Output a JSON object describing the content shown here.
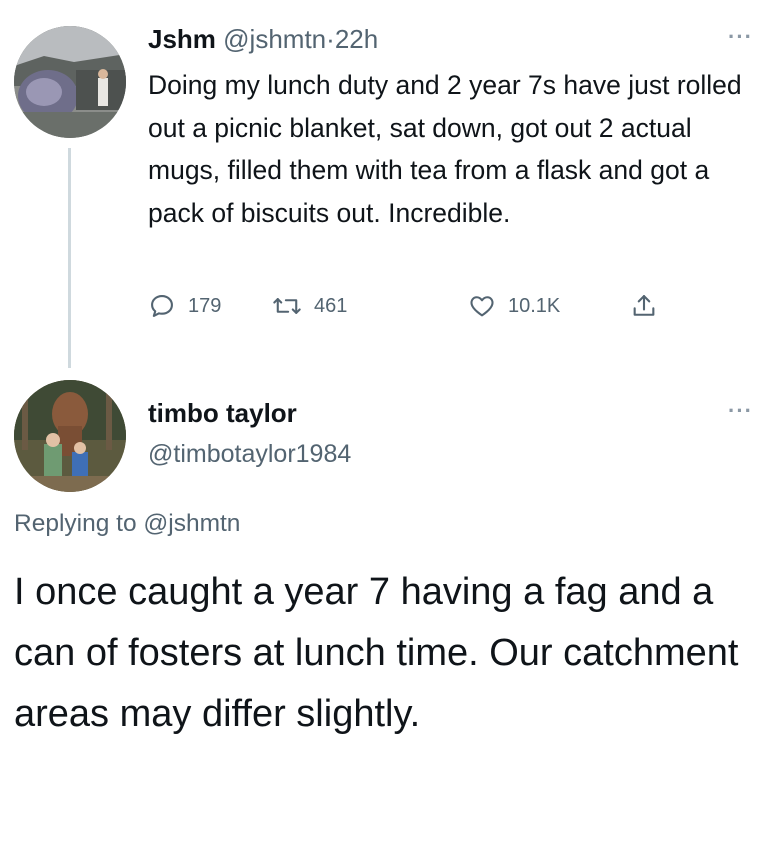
{
  "original_tweet": {
    "display_name": "Jshm",
    "handle": "@jshmtn",
    "separator": "·",
    "time": "22h",
    "text": "Doing my lunch duty and 2 year 7s have just rolled out a picnic blanket, sat down, got out 2 actual mugs, filled them with tea from a flask and got a pack of biscuits out. Incredible.",
    "actions": {
      "reply_icon": "reply-bubble-icon",
      "reply_count": "179",
      "retweet_icon": "retweet-arrows-icon",
      "retweet_count": "461",
      "like_icon": "heart-outline-icon",
      "like_count": "10.1K",
      "share_icon": "share-upload-icon"
    },
    "more_label": "···"
  },
  "reply_tweet": {
    "display_name": "timbo taylor",
    "handle": "@timbotaylor1984",
    "more_label": "···",
    "replying_prefix": "Replying to",
    "replying_to": "@jshmtn",
    "text": "I once caught a year 7 having a fag and a can of fosters at lunch time. Our catchment areas may differ slightly."
  },
  "colors": {
    "text_primary": "#0f1419",
    "text_secondary": "#536471",
    "thread_line": "#cfd9de",
    "background": "#ffffff"
  }
}
